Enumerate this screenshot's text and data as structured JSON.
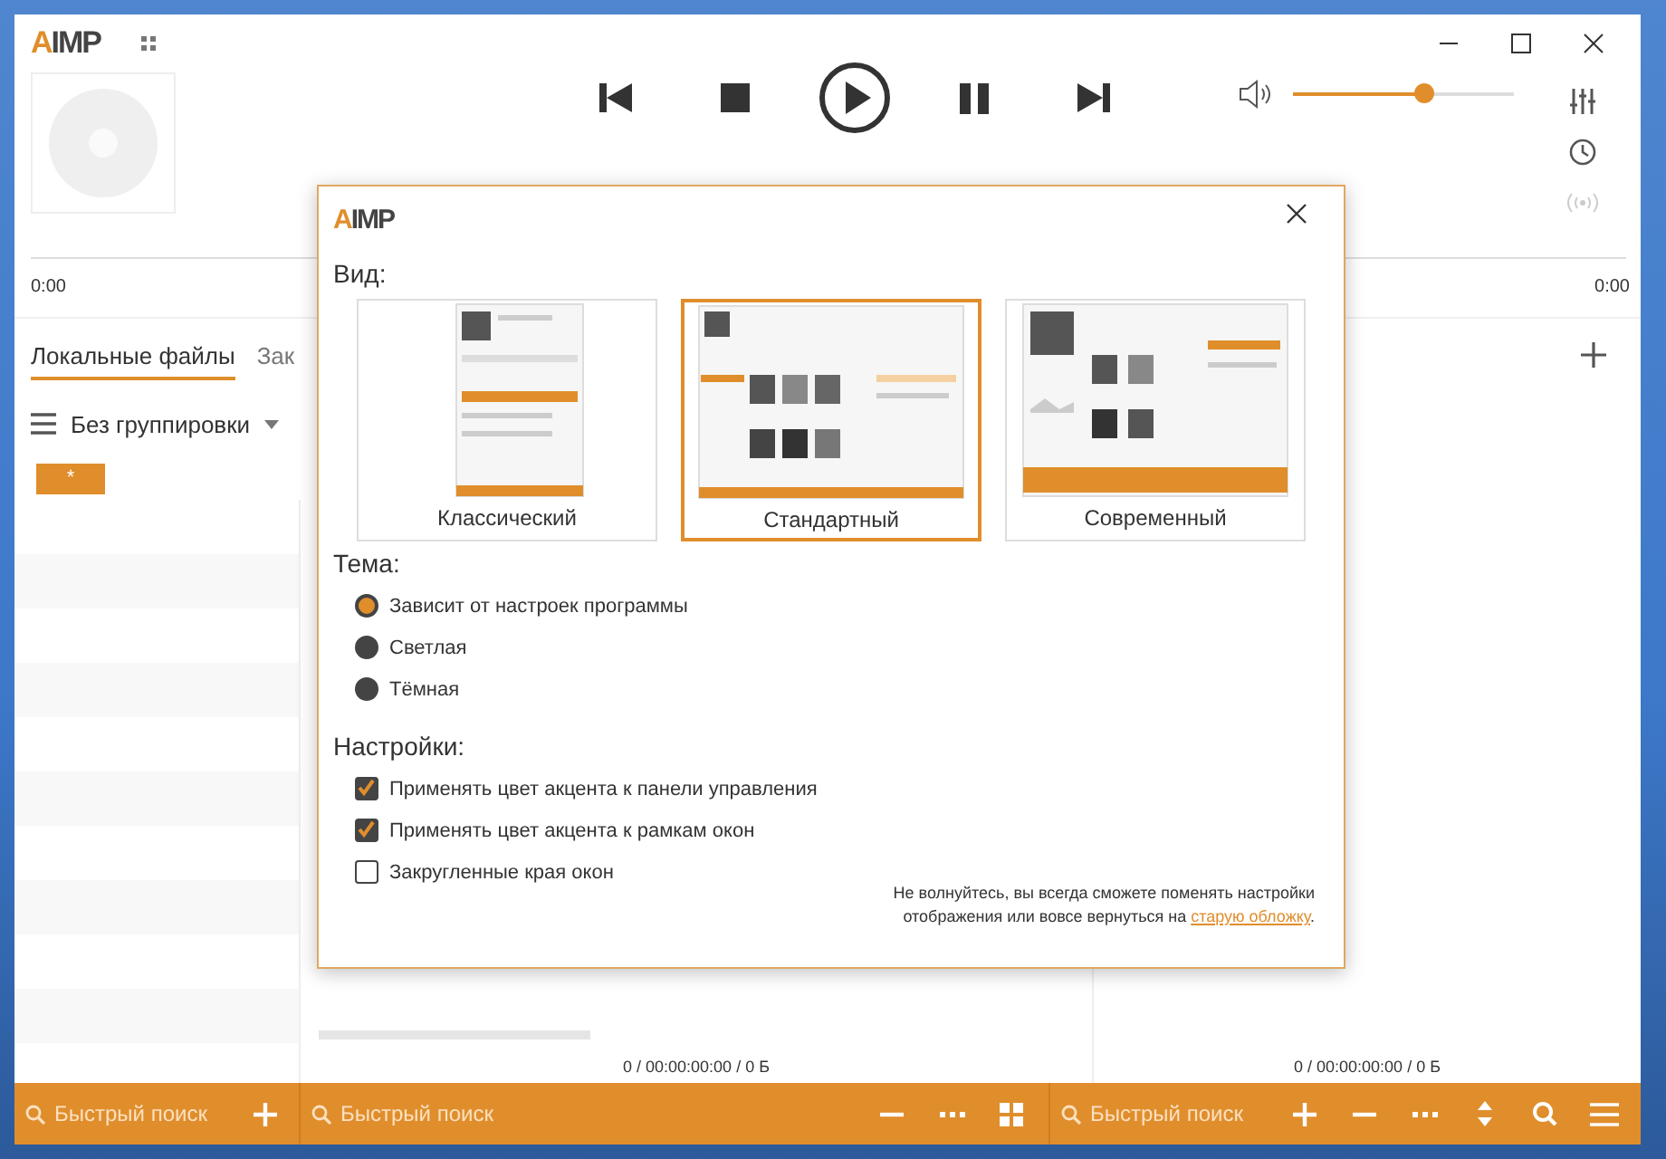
{
  "window": {
    "logo": "AIMP"
  },
  "player": {
    "time_elapsed": "0:00",
    "time_total": "0:00",
    "volume": {
      "level": 0.59
    }
  },
  "tabs": [
    {
      "label": "Локальные файлы",
      "selected": true
    },
    {
      "label": "Зак",
      "selected": false
    }
  ],
  "grouping": {
    "label": "Без группировки",
    "badge": "*"
  },
  "status": [
    "0 / 00:00:00:00 / 0 Б",
    "0 / 00:00:00:00 / 0 Б"
  ],
  "bottom_bar": {
    "search_placeholders": [
      "Быстрый поиск",
      "Быстрый поиск",
      "Быстрый поиск"
    ]
  },
  "dialog": {
    "logo": "AIMP",
    "view_heading": "Вид:",
    "views": [
      {
        "label": "Классический",
        "selected": false,
        "kind": "picture"
      },
      {
        "label": "Стандартный",
        "selected": true,
        "kind": "picture"
      },
      {
        "label": "Современный",
        "selected": false,
        "kind": "picture"
      }
    ],
    "theme_heading": "Тема:",
    "themes": [
      {
        "label": "Зависит от настроек программы",
        "selected": true
      },
      {
        "label": "Светлая",
        "selected": false
      },
      {
        "label": "Тёмная",
        "selected": false
      }
    ],
    "settings_heading": "Настройки:",
    "settings": [
      {
        "label": "Применять цвет акцента к панели управления",
        "checked": true
      },
      {
        "label": "Применять цвет акцента к рамкам окон",
        "checked": true
      },
      {
        "label": "Закругленные края окон",
        "checked": false
      }
    ],
    "note": "Не волнуйтесь, вы всегда сможете поменять настройки отображения или вовсе вернуться на",
    "note_link": "старую обложку",
    "note_end": "."
  }
}
